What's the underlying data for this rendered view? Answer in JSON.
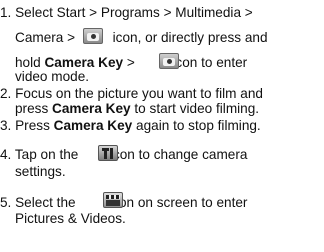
{
  "steps": {
    "s1": {
      "l1": "1. Select Start > Programs > Multimedia >",
      "l2a": "Camera >",
      "l2b": "icon, or directly press and",
      "l3a": "hold",
      "l3b": "Camera Key",
      "l3c": ">",
      "l3d": "icon to enter",
      "l4": "video mode."
    },
    "s2": {
      "l1": "2. Focus on the picture you want to film and",
      "l2a": "press",
      "l2b": "Camera Key",
      "l2c": "to start video filming."
    },
    "s3": {
      "l1a": "3. Press",
      "l1b": "Camera Key",
      "l1c": "again to stop filming."
    },
    "s4": {
      "l1a": "4. Tap on the",
      "l1b": "icon to change camera",
      "l2": "settings."
    },
    "s5": {
      "l1a": "5. Select the",
      "l1b": "icon on screen to enter",
      "l2": "Pictures & Videos."
    }
  },
  "icons": {
    "camera": "camera-icon",
    "tools": "tools-icon",
    "film": "film-clapper-icon"
  }
}
